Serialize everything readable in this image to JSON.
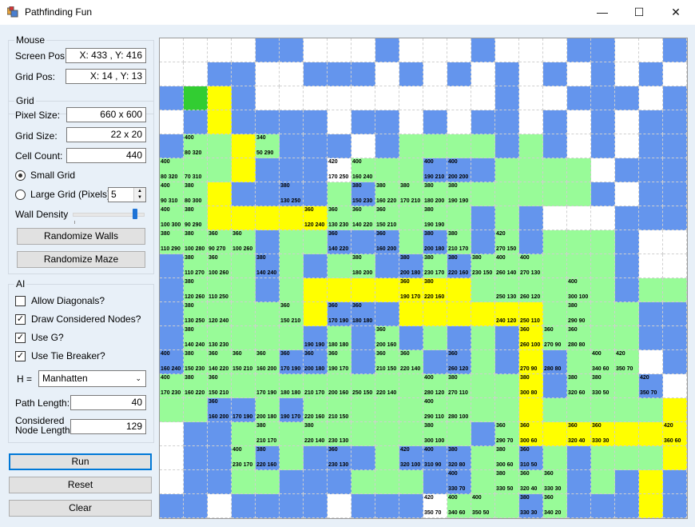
{
  "window": {
    "title": "Pathfinding Fun",
    "minimize": "—",
    "maximize": "☐",
    "close": "✕"
  },
  "mouse": {
    "group_label": "Mouse",
    "screen_pos_label": "Screen Pos:",
    "screen_pos_value": "X: 433 , Y: 416",
    "grid_pos_label": "Grid Pos:",
    "grid_pos_value": "X: 14 , Y: 13"
  },
  "grid_settings": {
    "group_label": "Grid",
    "pixel_size_label": "Pixel Size:",
    "pixel_size_value": "660 x 600",
    "grid_size_label": "Grid Size:",
    "grid_size_value": "22 x 20",
    "cell_count_label": "Cell Count:",
    "cell_count_value": "440",
    "small_grid_label": "Small Grid",
    "large_grid_label": "Large Grid (Pixels)",
    "large_grid_value": "5",
    "wall_density_label": "Wall Density",
    "wall_density_level": 0.9,
    "randomize_walls_label": "Randomize Walls",
    "randomize_maze_label": "Randomize Maze"
  },
  "ai": {
    "group_label": "AI",
    "allow_diagonals_label": "Allow Diagonals?",
    "allow_diagonals": false,
    "draw_considered_label": "Draw Considered Nodes?",
    "draw_considered": true,
    "use_g_label": "Use G?",
    "use_g": true,
    "use_tie_breaker_label": "Use Tie Breaker?",
    "use_tie_breaker": true,
    "h_label": "H =",
    "h_value": "Manhatten",
    "path_length_label": "Path Length:",
    "path_length_value": "40",
    "considered_label_1": "Considered",
    "considered_label_2": "Node Length:",
    "considered_value": "129"
  },
  "buttons": {
    "run": "Run",
    "reset": "Reset",
    "clear": "Clear"
  },
  "colors": {
    "wall": "#6495ed",
    "considered": "#98fb98",
    "path": "#ffff00",
    "start": "#32cd32",
    "end": "#ff0000",
    "empty": "#ffffff"
  },
  "map": {
    "legend": {
      "W": "wall",
      "C": "considered node",
      "P": "path",
      "S": "start",
      "E": "end",
      ".": "empty"
    },
    "rows": [
      "....WW...W...W...WW..W",
      "..WW..WWW.W.W.W.W.W.W.",
      "WSPW..........W..WWW.W",
      ".WPWWWW.WW.W.WW.W.W.WW",
      "WCCPCWWW.WCCCCWCW.W.WW",
      "CCCPWWW.CCCWWWCCCC.WWW",
      "CCPWWWWCWCCCCCCCCCW.WW",
      "CCPPPPPCCCCCCWCW...WWW",
      "CCCCWCCWWWCWCWCWCCCW..",
      "WCCCWCWCCWWCWCCCCCCW..",
      "WCCCWCPPPPPPPCCCCCCWCC",
      "WCCCCCPWWWPPPPPPCCCCWW",
      "WCCCCCWCWCWCWCWPCCCCWW",
      "WCCCCWWCWCCWWCWPWCCC.W",
      "CCCCCCCCCCCCCCCPWCCCW.",
      "CCWWCWCCCCCCCCCPCCCCCP",
      ".WWCCCCCCCCCCWCPPPPPPP",
      ".WWCWCWWWCWWWCCWCWCCCP",
      ".WWCCWWWCCCWWCCCCWCWPW",
      "WW.WWWW.WWW.CCCWCWWWPW",
      "WWW...WWWW.WCCWCCWWWE."
    ],
    "cell_values": [
      {
        "r": 4,
        "c": 1,
        "tl": "400",
        "bl": "80  320"
      },
      {
        "r": 4,
        "c": 4,
        "tl": "340",
        "bl": "50  290"
      },
      {
        "r": 5,
        "c": 0,
        "tl": "400",
        "bl": "80  320"
      },
      {
        "r": 5,
        "c": 1,
        "tl": "",
        "bl": "70  310"
      },
      {
        "r": 5,
        "c": 7,
        "tl": "420",
        "bl": "170 250"
      },
      {
        "r": 5,
        "c": 8,
        "tl": "400",
        "bl": "160 240"
      },
      {
        "r": 5,
        "c": 11,
        "tl": "400",
        "bl": "190 210"
      },
      {
        "r": 5,
        "c": 12,
        "tl": "400",
        "bl": "200 200"
      },
      {
        "r": 6,
        "c": 0,
        "tl": "400",
        "bl": "90  310"
      },
      {
        "r": 6,
        "c": 1,
        "tl": "380",
        "bl": "80  300"
      },
      {
        "r": 6,
        "c": 5,
        "tl": "380",
        "bl": "130 250"
      },
      {
        "r": 6,
        "c": 8,
        "tl": "380",
        "bl": "150 230"
      },
      {
        "r": 6,
        "c": 9,
        "tl": "380",
        "bl": "160 220"
      },
      {
        "r": 6,
        "c": 10,
        "tl": "380",
        "bl": "170 210"
      },
      {
        "r": 6,
        "c": 11,
        "tl": "380",
        "bl": "180 200"
      },
      {
        "r": 6,
        "c": 12,
        "tl": "380",
        "bl": "190 190"
      },
      {
        "r": 7,
        "c": 0,
        "tl": "400",
        "bl": "100 300"
      },
      {
        "r": 7,
        "c": 1,
        "tl": "380",
        "bl": "90  290"
      },
      {
        "r": 7,
        "c": 6,
        "tl": "360",
        "bl": "120 240"
      },
      {
        "r": 7,
        "c": 7,
        "tl": "360",
        "bl": "130 230"
      },
      {
        "r": 7,
        "c": 8,
        "tl": "360",
        "bl": "140 220"
      },
      {
        "r": 7,
        "c": 9,
        "tl": "360",
        "bl": "150 210"
      },
      {
        "r": 7,
        "c": 11,
        "tl": "380",
        "bl": "190 190"
      },
      {
        "r": 8,
        "c": 0,
        "tl": "380",
        "bl": "110 290"
      },
      {
        "r": 8,
        "c": 1,
        "tl": "380",
        "bl": "100 280"
      },
      {
        "r": 8,
        "c": 2,
        "tl": "360",
        "bl": "90  270"
      },
      {
        "r": 8,
        "c": 3,
        "tl": "360",
        "bl": "100 260"
      },
      {
        "r": 8,
        "c": 7,
        "tl": "360",
        "bl": "140 220"
      },
      {
        "r": 8,
        "c": 9,
        "tl": "360",
        "bl": "160 200"
      },
      {
        "r": 8,
        "c": 11,
        "tl": "380",
        "bl": "200 180"
      },
      {
        "r": 8,
        "c": 12,
        "tl": "380",
        "bl": "210 170"
      },
      {
        "r": 8,
        "c": 14,
        "tl": "420",
        "bl": "270 150"
      },
      {
        "r": 9,
        "c": 1,
        "tl": "380",
        "bl": "110 270"
      },
      {
        "r": 9,
        "c": 2,
        "tl": "360",
        "bl": "100 260"
      },
      {
        "r": 9,
        "c": 4,
        "tl": "380",
        "bl": "140 240"
      },
      {
        "r": 9,
        "c": 8,
        "tl": "380",
        "bl": "180 200"
      },
      {
        "r": 9,
        "c": 10,
        "tl": "380",
        "bl": "200 180"
      },
      {
        "r": 9,
        "c": 11,
        "tl": "380",
        "bl": "230 170"
      },
      {
        "r": 9,
        "c": 12,
        "tl": "380",
        "bl": "220 160"
      },
      {
        "r": 9,
        "c": 13,
        "tl": "380",
        "bl": "230 150"
      },
      {
        "r": 9,
        "c": 14,
        "tl": "400",
        "bl": "260 140"
      },
      {
        "r": 9,
        "c": 15,
        "tl": "400",
        "bl": "270 130"
      },
      {
        "r": 10,
        "c": 1,
        "tl": "380",
        "bl": "120 260"
      },
      {
        "r": 10,
        "c": 2,
        "tl": "",
        "bl": "110 250"
      },
      {
        "r": 10,
        "c": 10,
        "tl": "360",
        "bl": "190 170"
      },
      {
        "r": 10,
        "c": 11,
        "tl": "380",
        "bl": "220 160"
      },
      {
        "r": 10,
        "c": 14,
        "tl": "",
        "bl": "250 130"
      },
      {
        "r": 10,
        "c": 15,
        "tl": "",
        "bl": "260 120"
      },
      {
        "r": 10,
        "c": 17,
        "tl": "400",
        "bl": "300 100"
      },
      {
        "r": 11,
        "c": 1,
        "tl": "380",
        "bl": "130 250"
      },
      {
        "r": 11,
        "c": 2,
        "tl": "",
        "bl": "120 240"
      },
      {
        "r": 11,
        "c": 5,
        "tl": "360",
        "bl": "150 210"
      },
      {
        "r": 11,
        "c": 7,
        "tl": "360",
        "bl": "170 190"
      },
      {
        "r": 11,
        "c": 8,
        "tl": "360",
        "bl": "180 180"
      },
      {
        "r": 11,
        "c": 14,
        "tl": "",
        "bl": "240 120"
      },
      {
        "r": 11,
        "c": 15,
        "tl": "",
        "bl": "250 110"
      },
      {
        "r": 11,
        "c": 17,
        "tl": "380",
        "bl": "290 90"
      },
      {
        "r": 12,
        "c": 1,
        "tl": "380",
        "bl": "140 240"
      },
      {
        "r": 12,
        "c": 2,
        "tl": "",
        "bl": "130 230"
      },
      {
        "r": 12,
        "c": 6,
        "tl": "",
        "bl": "190 190"
      },
      {
        "r": 12,
        "c": 7,
        "tl": "",
        "bl": "180 180"
      },
      {
        "r": 12,
        "c": 9,
        "tl": "360",
        "bl": "200 160"
      },
      {
        "r": 12,
        "c": 15,
        "tl": "360",
        "bl": "260 100"
      },
      {
        "r": 12,
        "c": 16,
        "tl": "360",
        "bl": "270 90"
      },
      {
        "r": 12,
        "c": 17,
        "tl": "360",
        "bl": "280 80"
      },
      {
        "r": 13,
        "c": 0,
        "tl": "400",
        "bl": "160 240"
      },
      {
        "r": 13,
        "c": 1,
        "tl": "380",
        "bl": "150 230"
      },
      {
        "r": 13,
        "c": 2,
        "tl": "360",
        "bl": "140 220"
      },
      {
        "r": 13,
        "c": 3,
        "tl": "360",
        "bl": "150 210"
      },
      {
        "r": 13,
        "c": 4,
        "tl": "360",
        "bl": "160 200"
      },
      {
        "r": 13,
        "c": 5,
        "tl": "360",
        "bl": "170 190"
      },
      {
        "r": 13,
        "c": 6,
        "tl": "360",
        "bl": "200 180"
      },
      {
        "r": 13,
        "c": 7,
        "tl": "360",
        "bl": "190 170"
      },
      {
        "r": 13,
        "c": 9,
        "tl": "360",
        "bl": "210 150"
      },
      {
        "r": 13,
        "c": 10,
        "tl": "360",
        "bl": "220 140"
      },
      {
        "r": 13,
        "c": 12,
        "tl": "360",
        "bl": "260 120"
      },
      {
        "r": 13,
        "c": 15,
        "tl": "",
        "bl": "270 90"
      },
      {
        "r": 13,
        "c": 16,
        "tl": "",
        "bl": "280 80"
      },
      {
        "r": 13,
        "c": 18,
        "tl": "400",
        "bl": "340 60"
      },
      {
        "r": 13,
        "c": 19,
        "tl": "420",
        "bl": "350 70"
      },
      {
        "r": 14,
        "c": 0,
        "tl": "400",
        "bl": "170 230"
      },
      {
        "r": 14,
        "c": 1,
        "tl": "380",
        "bl": "160 220"
      },
      {
        "r": 14,
        "c": 2,
        "tl": "360",
        "bl": "150 210"
      },
      {
        "r": 14,
        "c": 4,
        "tl": "",
        "bl": "170 190"
      },
      {
        "r": 14,
        "c": 5,
        "tl": "",
        "bl": "180 180"
      },
      {
        "r": 14,
        "c": 6,
        "tl": "",
        "bl": "210 170"
      },
      {
        "r": 14,
        "c": 7,
        "tl": "",
        "bl": "200 160"
      },
      {
        "r": 14,
        "c": 8,
        "tl": "",
        "bl": "250 150"
      },
      {
        "r": 14,
        "c": 9,
        "tl": "",
        "bl": "220 140"
      },
      {
        "r": 14,
        "c": 11,
        "tl": "400",
        "bl": "280 120"
      },
      {
        "r": 14,
        "c": 12,
        "tl": "380",
        "bl": "270 110"
      },
      {
        "r": 14,
        "c": 15,
        "tl": "380",
        "bl": "300 80"
      },
      {
        "r": 14,
        "c": 17,
        "tl": "380",
        "bl": "320 60"
      },
      {
        "r": 14,
        "c": 18,
        "tl": "380",
        "bl": "330 50"
      },
      {
        "r": 14,
        "c": 20,
        "tl": "420",
        "bl": "350 70"
      },
      {
        "r": 15,
        "c": 2,
        "tl": "360",
        "bl": "160 200"
      },
      {
        "r": 15,
        "c": 3,
        "tl": "",
        "bl": "170 190"
      },
      {
        "r": 15,
        "c": 4,
        "tl": "",
        "bl": "200 180"
      },
      {
        "r": 15,
        "c": 5,
        "tl": "",
        "bl": "190 170"
      },
      {
        "r": 15,
        "c": 6,
        "tl": "",
        "bl": "220 160"
      },
      {
        "r": 15,
        "c": 7,
        "tl": "",
        "bl": "210 150"
      },
      {
        "r": 15,
        "c": 11,
        "tl": "400",
        "bl": "290 110"
      },
      {
        "r": 15,
        "c": 12,
        "tl": "",
        "bl": "280 100"
      },
      {
        "r": 16,
        "c": 4,
        "tl": "380",
        "bl": "210 170"
      },
      {
        "r": 16,
        "c": 6,
        "tl": "380",
        "bl": "220 140"
      },
      {
        "r": 16,
        "c": 7,
        "tl": "",
        "bl": "230 130"
      },
      {
        "r": 16,
        "c": 11,
        "tl": "380",
        "bl": "300 100"
      },
      {
        "r": 16,
        "c": 14,
        "tl": "360",
        "bl": "290 70"
      },
      {
        "r": 16,
        "c": 15,
        "tl": "360",
        "bl": "300 60"
      },
      {
        "r": 16,
        "c": 17,
        "tl": "360",
        "bl": "320 40"
      },
      {
        "r": 16,
        "c": 18,
        "tl": "360",
        "bl": "330 30"
      },
      {
        "r": 16,
        "c": 21,
        "tl": "420",
        "bl": "360 60"
      },
      {
        "r": 17,
        "c": 3,
        "tl": "400",
        "bl": "230 170"
      },
      {
        "r": 17,
        "c": 4,
        "tl": "380",
        "bl": "220 160"
      },
      {
        "r": 17,
        "c": 7,
        "tl": "360",
        "bl": "230 130"
      },
      {
        "r": 17,
        "c": 10,
        "tl": "420",
        "bl": "320 100"
      },
      {
        "r": 17,
        "c": 11,
        "tl": "400",
        "bl": "310 90"
      },
      {
        "r": 17,
        "c": 12,
        "tl": "380",
        "bl": "320 80"
      },
      {
        "r": 17,
        "c": 14,
        "tl": "380",
        "bl": "300 60"
      },
      {
        "r": 17,
        "c": 15,
        "tl": "360",
        "bl": "310 50"
      },
      {
        "r": 18,
        "c": 12,
        "tl": "400",
        "bl": "330 70"
      },
      {
        "r": 18,
        "c": 14,
        "tl": "380",
        "bl": "330 50"
      },
      {
        "r": 18,
        "c": 15,
        "tl": "360",
        "bl": "320 40"
      },
      {
        "r": 18,
        "c": 16,
        "tl": "360",
        "bl": "330 30"
      },
      {
        "r": 19,
        "c": 11,
        "tl": "420",
        "bl": "350 70"
      },
      {
        "r": 19,
        "c": 12,
        "tl": "400",
        "bl": "340 60"
      },
      {
        "r": 19,
        "c": 13,
        "tl": "400",
        "bl": "350 50"
      },
      {
        "r": 19,
        "c": 15,
        "tl": "380",
        "bl": "330 30"
      },
      {
        "r": 19,
        "c": 16,
        "tl": "360",
        "bl": "340 20"
      }
    ]
  }
}
